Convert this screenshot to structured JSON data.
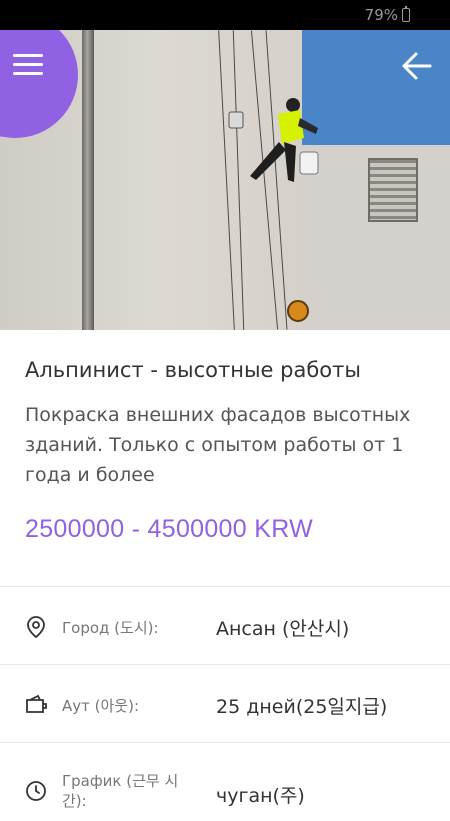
{
  "status_bar": {
    "battery": "79%"
  },
  "hero": {
    "image_description_icon": "climber-photo"
  },
  "header": {
    "menu_icon": "hamburger-icon",
    "back_icon": "arrow-left-icon"
  },
  "job": {
    "title": "Альпинист - высотные работы",
    "description": "Покраска внешних фасадов высотных зданий. Только с опытом работы от 1 года и более",
    "salary": "2500000 - 4500000 KRW"
  },
  "details": [
    {
      "icon": "location-pin-icon",
      "label": "Город (도시):",
      "value": "Ансан (안산시)"
    },
    {
      "icon": "wallet-icon",
      "label": "Аут (아웃):",
      "value": "25 дней(25일지급)"
    },
    {
      "icon": "clock-icon",
      "label": "График (근무 시간):",
      "value": "чуган(주)"
    }
  ],
  "colors": {
    "accent": "#9061e3",
    "status_bar": "#000000",
    "sky": "#4a86c7"
  }
}
